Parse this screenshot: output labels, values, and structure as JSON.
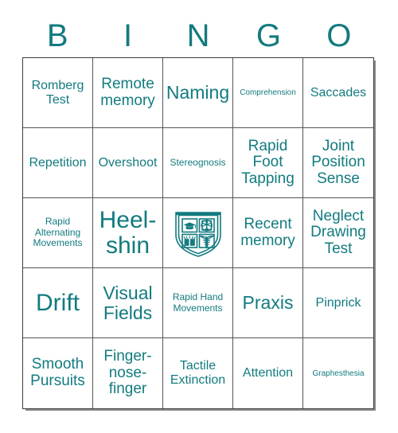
{
  "header": {
    "letters": [
      "B",
      "I",
      "N",
      "G",
      "O"
    ],
    "accent_color": "#127b7f"
  },
  "grid": {
    "rows": 5,
    "columns": 5,
    "border_color": "#555555",
    "cells": [
      {
        "label": "Romberg Test",
        "size": "m"
      },
      {
        "label": "Remote memory",
        "size": "l"
      },
      {
        "label": "Naming",
        "size": "xl"
      },
      {
        "label": "Comprehension",
        "size": "xxs"
      },
      {
        "label": "Saccades",
        "size": "m"
      },
      {
        "label": "Repetition",
        "size": "m"
      },
      {
        "label": "Overshoot",
        "size": "m"
      },
      {
        "label": "Stereognosis",
        "size": "xs"
      },
      {
        "label": "Rapid Foot Tapping",
        "size": "l"
      },
      {
        "label": "Joint Position Sense",
        "size": "l"
      },
      {
        "label": "Rapid Alternating Movements",
        "size": "xs"
      },
      {
        "label": "Heel-shin",
        "size": "xxl"
      },
      {
        "label": "",
        "size": "m",
        "icon": "university-shield-crest-logo",
        "free": true
      },
      {
        "label": "Recent memory",
        "size": "l"
      },
      {
        "label": "Neglect Drawing Test",
        "size": "l"
      },
      {
        "label": "Drift",
        "size": "xxl"
      },
      {
        "label": "Visual Fields",
        "size": "xl"
      },
      {
        "label": "Rapid Hand Movements",
        "size": "xs"
      },
      {
        "label": "Praxis",
        "size": "xl"
      },
      {
        "label": "Pinprick",
        "size": "m"
      },
      {
        "label": "Smooth Pursuits",
        "size": "l"
      },
      {
        "label": "Finger-nose-finger",
        "size": "l"
      },
      {
        "label": "Tactile Extinction",
        "size": "m"
      },
      {
        "label": "Attention",
        "size": "m"
      },
      {
        "label": "Graphesthesia",
        "size": "xxs"
      }
    ]
  }
}
